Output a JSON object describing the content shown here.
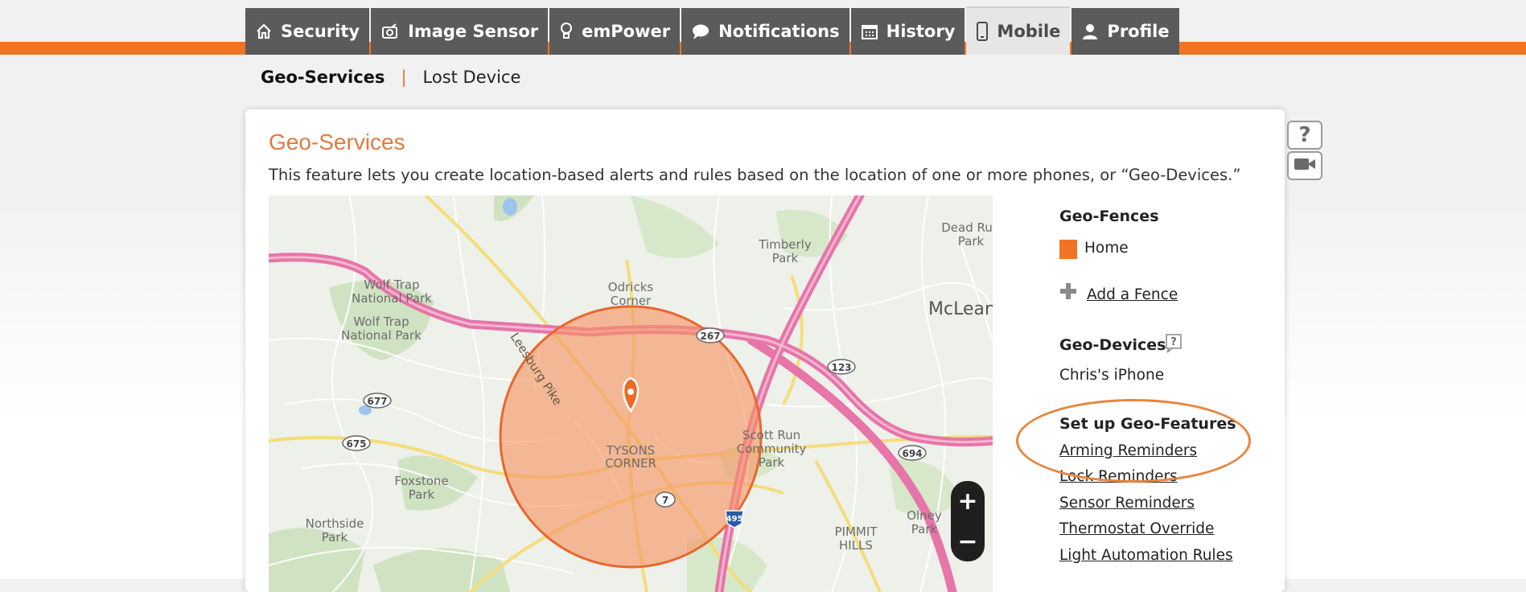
{
  "tabs": [
    {
      "label": "Security",
      "icon": "house-icon"
    },
    {
      "label": "Image Sensor",
      "icon": "camera-icon"
    },
    {
      "label": "emPower",
      "icon": "lightbulb-icon"
    },
    {
      "label": "Notifications",
      "icon": "chat-bubble-icon"
    },
    {
      "label": "History",
      "icon": "calendar-icon"
    },
    {
      "label": "Mobile",
      "icon": "phone-icon",
      "active": true
    },
    {
      "label": "Profile",
      "icon": "user-icon"
    }
  ],
  "subnav": {
    "active": "Geo-Services",
    "separator": "|",
    "link": "Lost Device"
  },
  "panel": {
    "title": "Geo-Services",
    "description": "This feature lets you create location-based alerts and rules based on the location of one or more phones, or “Geo-Devices.”"
  },
  "map": {
    "labels": {
      "wolf1": "Wolf Trap",
      "wolf2": "National Park",
      "wolf3": "Wolf Trap",
      "wolf4": "National Park",
      "odricks1": "Odricks",
      "odricks2": "Corner",
      "timberly1": "Timberly",
      "timberly2": "Park",
      "deadrun1": "Dead Ru",
      "deadrun2": "Park",
      "mclean": "McLean",
      "leesburg": "Leesburg Pike",
      "tysons1": "TYSONS",
      "tysons2": "CORNER",
      "scott1": "Scott Run",
      "scott2": "Community",
      "scott3": "Park",
      "fox1": "Foxstone",
      "fox2": "Park",
      "north1": "Northside",
      "north2": "Park",
      "pimmit1": "PIMMIT",
      "pimmit2": "HILLS",
      "olney1": "Olney",
      "olney2": "Park",
      "r267": "267",
      "r123": "123",
      "r677": "677",
      "r675": "675",
      "r694": "694",
      "r7": "7",
      "r495": "495"
    },
    "zoom_in": "+",
    "zoom_out": "−"
  },
  "sidebar": {
    "geo_fences_heading": "Geo-Fences",
    "fence_name": "Home",
    "fence_color": "#f07423",
    "add_fence": "Add a Fence",
    "geo_devices_heading": "Geo-Devices",
    "device": "Chris's iPhone",
    "features_heading": "Set up Geo-Features",
    "features": [
      "Arming Reminders",
      "Lock Reminders",
      "Sensor Reminders",
      "Thermostat Override",
      "Light Automation Rules"
    ]
  },
  "help_button": "?",
  "colors": {
    "accent": "#f07423",
    "title": "#e07b3f",
    "tab_bg": "#5b5b5b",
    "highway": "#e675a8"
  }
}
